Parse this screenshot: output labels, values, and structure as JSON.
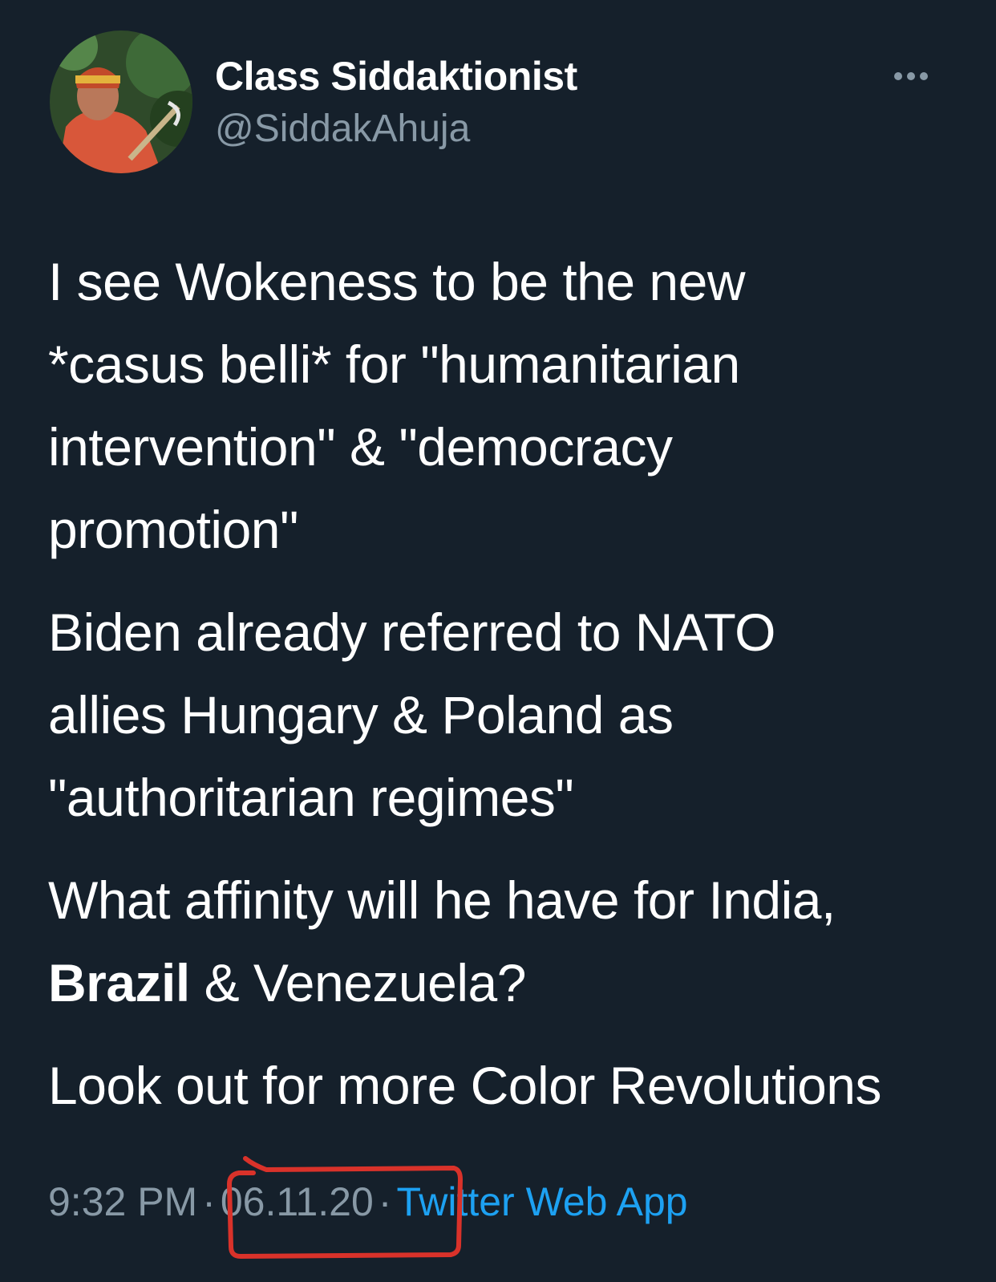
{
  "tweet": {
    "author": {
      "display_name": "Class Siddaktionist",
      "handle": "@SiddakAhuja"
    },
    "more_icon": "ellipsis-horizontal-icon",
    "paragraphs": [
      "I see Wokeness to be the new\n*casus belli* for \"humanitarian\nintervention\" & \"democracy\npromotion\"",
      "Biden already referred to NATO\nallies Hungary & Poland as\n\"authoritarian regimes\""
    ],
    "paragraph_3": {
      "line1": "What affinity will he have for India,",
      "bold_word": "Brazil",
      "line2_rest": " & Venezuela?"
    },
    "paragraph_4": "Look out for more Color Revolutions",
    "meta": {
      "time": "9:32 PM",
      "separator": "·",
      "date": "06.11.20",
      "source": "Twitter Web App"
    }
  },
  "colors": {
    "background": "#15202b",
    "text_primary": "#ffffff",
    "text_secondary": "#8899a6",
    "link": "#1da1f2",
    "annotation": "#d9322a"
  }
}
